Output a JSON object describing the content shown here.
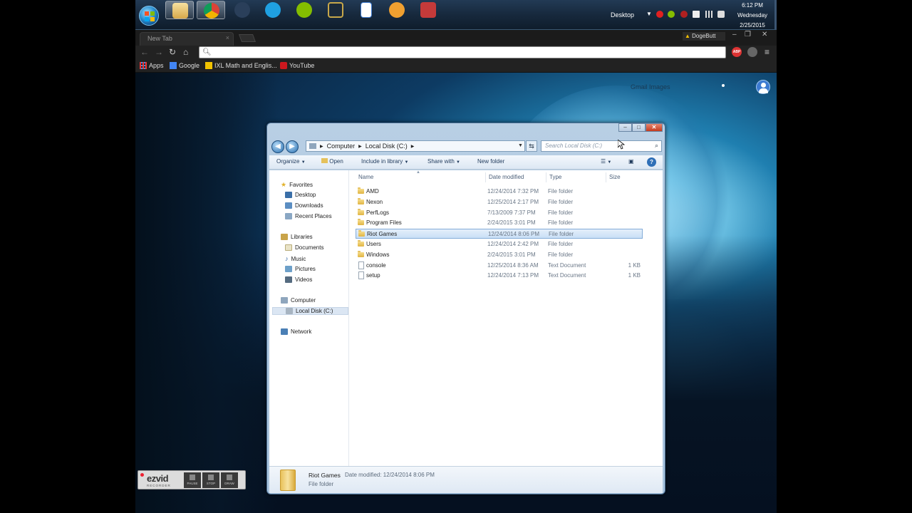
{
  "taskbar": {
    "apps": [
      "Windows Explorer",
      "Google Chrome",
      "Steam",
      "Skype",
      "Spotify",
      "League of Legends",
      "Document",
      "App",
      "Game"
    ],
    "desktop_label": "Desktop",
    "clock": {
      "time": "6:12 PM",
      "day": "Wednesday",
      "date": "2/25/2015"
    }
  },
  "chrome": {
    "tab_title": "New Tab",
    "profile_name": "DogeButt",
    "omnibox_placeholder": "",
    "extension_label": "ABP",
    "bookmarks": [
      {
        "label": "Apps",
        "icon": "apps-grid-icon"
      },
      {
        "label": "Google",
        "icon": "google-icon"
      },
      {
        "label": "IXL Math and Englis...",
        "icon": "ixl-icon"
      },
      {
        "label": "YouTube",
        "icon": "youtube-icon"
      }
    ],
    "google_bar": "Gmail   Images"
  },
  "explorer": {
    "breadcrumb": [
      "Computer",
      "Local Disk (C:)"
    ],
    "search_placeholder": "Search Local Disk (C:)",
    "commands": {
      "organize": "Organize",
      "open": "Open",
      "include": "Include in library",
      "share": "Share with",
      "new_folder": "New folder"
    },
    "nav": {
      "favorites": "Favorites",
      "favorites_items": [
        "Desktop",
        "Downloads",
        "Recent Places"
      ],
      "libraries": "Libraries",
      "library_items": [
        "Documents",
        "Music",
        "Pictures",
        "Videos"
      ],
      "computer": "Computer",
      "computer_items": [
        "Local Disk (C:)"
      ],
      "network": "Network"
    },
    "columns": {
      "name": "Name",
      "date": "Date modified",
      "type": "Type",
      "size": "Size"
    },
    "files": [
      {
        "name": "AMD",
        "date": "12/24/2014 7:32 PM",
        "type": "File folder",
        "size": "",
        "kind": "folder"
      },
      {
        "name": "Nexon",
        "date": "12/25/2014 2:17 PM",
        "type": "File folder",
        "size": "",
        "kind": "folder"
      },
      {
        "name": "PerfLogs",
        "date": "7/13/2009 7:37 PM",
        "type": "File folder",
        "size": "",
        "kind": "folder"
      },
      {
        "name": "Program Files",
        "date": "2/24/2015 3:01 PM",
        "type": "File folder",
        "size": "",
        "kind": "folder"
      },
      {
        "name": "Riot Games",
        "date": "12/24/2014 8:06 PM",
        "type": "File folder",
        "size": "",
        "kind": "folder",
        "selected": true
      },
      {
        "name": "Users",
        "date": "12/24/2014 2:42 PM",
        "type": "File folder",
        "size": "",
        "kind": "folder"
      },
      {
        "name": "Windows",
        "date": "2/24/2015 3:01 PM",
        "type": "File folder",
        "size": "",
        "kind": "folder"
      },
      {
        "name": "console",
        "date": "12/25/2014 8:36 AM",
        "type": "Text Document",
        "size": "1 KB",
        "kind": "doc"
      },
      {
        "name": "setup",
        "date": "12/24/2014 7:13 PM",
        "type": "Text Document",
        "size": "1 KB",
        "kind": "doc"
      }
    ],
    "details": {
      "name": "Riot Games",
      "modified": "Date modified: 12/24/2014 8:06 PM",
      "type": "File folder"
    }
  },
  "recorder": {
    "logo": "ezvid",
    "sub": "RECORDER",
    "buttons": [
      "PAUSE",
      "STOP",
      "DRAW"
    ]
  }
}
